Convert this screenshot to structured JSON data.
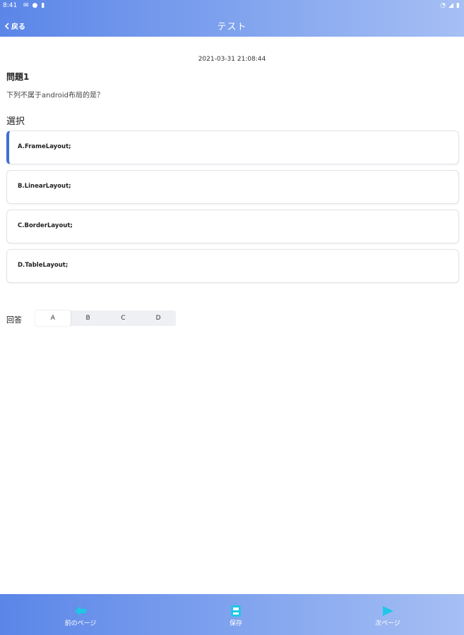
{
  "statusbar": {
    "time": "8:41"
  },
  "header": {
    "back_label": "戻る",
    "title": "テスト"
  },
  "question": {
    "timestamp": "2021-03-31 21:08:44",
    "title": "問題1",
    "text": "下列不属于android布局的是？"
  },
  "options_section": {
    "title": "選択",
    "options": [
      {
        "label": "A.FrameLayout;"
      },
      {
        "label": "B.LinearLayout;"
      },
      {
        "label": "C.BorderLayout;"
      },
      {
        "label": "D.TableLayout;"
      }
    ]
  },
  "answer": {
    "label": "回答",
    "choices": [
      "A",
      "B",
      "C",
      "D"
    ],
    "selected": "A"
  },
  "footer": {
    "prev_label": "前のページ",
    "save_label": "保存",
    "next_label": "次ページ"
  },
  "colors": {
    "accent": "#3f6fd8",
    "header_start": "#5b86e8",
    "header_end": "#a6bff4",
    "icon_cyan": "#1fc7e6"
  }
}
